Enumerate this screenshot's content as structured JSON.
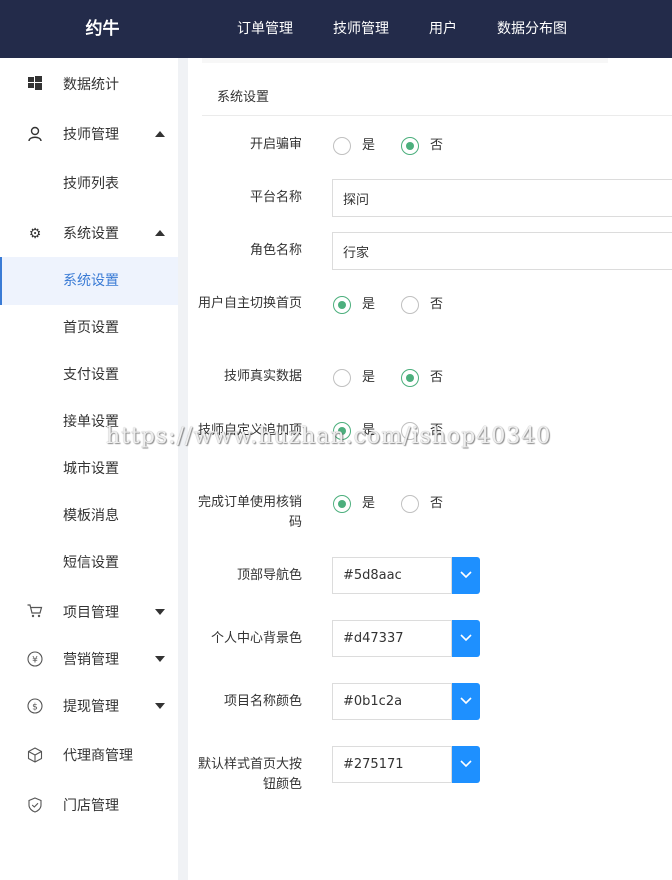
{
  "app": {
    "title": "约牛"
  },
  "topnav": {
    "items": [
      "订单管理",
      "技师管理",
      "用户",
      "数据分布图"
    ]
  },
  "sidebar": {
    "items": [
      {
        "label": "数据统计",
        "icon": "windows-icon"
      },
      {
        "label": "技师管理",
        "icon": "user-icon",
        "expanded": true
      },
      {
        "label": "技师列表"
      },
      {
        "label": "系统设置",
        "icon": "gear-icon",
        "expanded": true
      },
      {
        "label": "系统设置",
        "active": true
      },
      {
        "label": "首页设置"
      },
      {
        "label": "支付设置"
      },
      {
        "label": "接单设置"
      },
      {
        "label": "城市设置"
      },
      {
        "label": "模板消息"
      },
      {
        "label": "短信设置"
      },
      {
        "label": "项目管理",
        "icon": "cart-icon",
        "expanded": false
      },
      {
        "label": "营销管理",
        "icon": "yen-icon",
        "expanded": false
      },
      {
        "label": "提现管理",
        "icon": "dollar-icon",
        "expanded": false
      },
      {
        "label": "代理商管理",
        "icon": "cube-icon"
      },
      {
        "label": "门店管理",
        "icon": "shield-icon"
      }
    ]
  },
  "form": {
    "section_title": "系统设置",
    "yes_label": "是",
    "no_label": "否",
    "review_mode": {
      "label": "开启骗审",
      "value": "否"
    },
    "platform_name": {
      "label": "平台名称",
      "value": "探问"
    },
    "role_name": {
      "label": "角色名称",
      "value": "行家"
    },
    "user_switch_home": {
      "label": "用户自主切换首页",
      "value": "是"
    },
    "tech_real_data": {
      "label": "技师真实数据",
      "value": "否"
    },
    "tech_custom_items": {
      "label": "技师自定义追加项",
      "value": "是"
    },
    "order_verify_code": {
      "label": "完成订单使用核销码",
      "value": "是"
    },
    "top_nav_color": {
      "label": "顶部导航色",
      "value": "#5d8aac"
    },
    "profile_bg_color": {
      "label": "个人中心背景色",
      "value": "#d47337"
    },
    "item_name_color": {
      "label": "项目名称颜色",
      "value": "#0b1c2a"
    },
    "default_home_btn_color": {
      "label": "默认样式首页大按钮颜色",
      "value": "#275171"
    }
  },
  "watermark": "https://www.huzhan.com/ishop40340",
  "colors": {
    "topbar": "#232b4a",
    "accent": "#3a7bd5",
    "radio": "#4caf7d",
    "picker": "#1e90ff"
  }
}
